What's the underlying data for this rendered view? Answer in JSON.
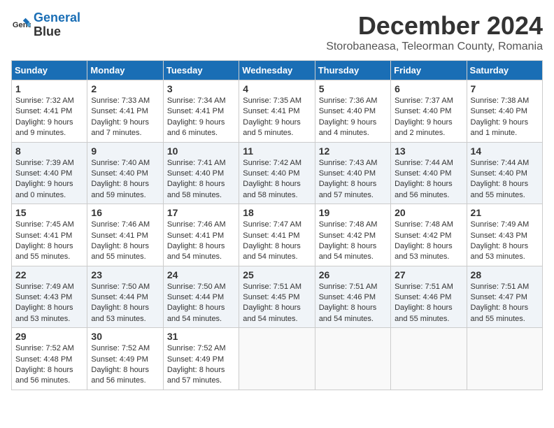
{
  "logo": {
    "line1": "General",
    "line2": "Blue"
  },
  "title": "December 2024",
  "location": "Storobaneasa, Teleorman County, Romania",
  "weekdays": [
    "Sunday",
    "Monday",
    "Tuesday",
    "Wednesday",
    "Thursday",
    "Friday",
    "Saturday"
  ],
  "weeks": [
    [
      {
        "day": "1",
        "sunrise": "7:32 AM",
        "sunset": "4:41 PM",
        "daylight": "9 hours and 9 minutes."
      },
      {
        "day": "2",
        "sunrise": "7:33 AM",
        "sunset": "4:41 PM",
        "daylight": "9 hours and 7 minutes."
      },
      {
        "day": "3",
        "sunrise": "7:34 AM",
        "sunset": "4:41 PM",
        "daylight": "9 hours and 6 minutes."
      },
      {
        "day": "4",
        "sunrise": "7:35 AM",
        "sunset": "4:41 PM",
        "daylight": "9 hours and 5 minutes."
      },
      {
        "day": "5",
        "sunrise": "7:36 AM",
        "sunset": "4:40 PM",
        "daylight": "9 hours and 4 minutes."
      },
      {
        "day": "6",
        "sunrise": "7:37 AM",
        "sunset": "4:40 PM",
        "daylight": "9 hours and 2 minutes."
      },
      {
        "day": "7",
        "sunrise": "7:38 AM",
        "sunset": "4:40 PM",
        "daylight": "9 hours and 1 minute."
      }
    ],
    [
      {
        "day": "8",
        "sunrise": "7:39 AM",
        "sunset": "4:40 PM",
        "daylight": "9 hours and 0 minutes."
      },
      {
        "day": "9",
        "sunrise": "7:40 AM",
        "sunset": "4:40 PM",
        "daylight": "8 hours and 59 minutes."
      },
      {
        "day": "10",
        "sunrise": "7:41 AM",
        "sunset": "4:40 PM",
        "daylight": "8 hours and 58 minutes."
      },
      {
        "day": "11",
        "sunrise": "7:42 AM",
        "sunset": "4:40 PM",
        "daylight": "8 hours and 58 minutes."
      },
      {
        "day": "12",
        "sunrise": "7:43 AM",
        "sunset": "4:40 PM",
        "daylight": "8 hours and 57 minutes."
      },
      {
        "day": "13",
        "sunrise": "7:44 AM",
        "sunset": "4:40 PM",
        "daylight": "8 hours and 56 minutes."
      },
      {
        "day": "14",
        "sunrise": "7:44 AM",
        "sunset": "4:40 PM",
        "daylight": "8 hours and 55 minutes."
      }
    ],
    [
      {
        "day": "15",
        "sunrise": "7:45 AM",
        "sunset": "4:41 PM",
        "daylight": "8 hours and 55 minutes."
      },
      {
        "day": "16",
        "sunrise": "7:46 AM",
        "sunset": "4:41 PM",
        "daylight": "8 hours and 55 minutes."
      },
      {
        "day": "17",
        "sunrise": "7:46 AM",
        "sunset": "4:41 PM",
        "daylight": "8 hours and 54 minutes."
      },
      {
        "day": "18",
        "sunrise": "7:47 AM",
        "sunset": "4:41 PM",
        "daylight": "8 hours and 54 minutes."
      },
      {
        "day": "19",
        "sunrise": "7:48 AM",
        "sunset": "4:42 PM",
        "daylight": "8 hours and 54 minutes."
      },
      {
        "day": "20",
        "sunrise": "7:48 AM",
        "sunset": "4:42 PM",
        "daylight": "8 hours and 53 minutes."
      },
      {
        "day": "21",
        "sunrise": "7:49 AM",
        "sunset": "4:43 PM",
        "daylight": "8 hours and 53 minutes."
      }
    ],
    [
      {
        "day": "22",
        "sunrise": "7:49 AM",
        "sunset": "4:43 PM",
        "daylight": "8 hours and 53 minutes."
      },
      {
        "day": "23",
        "sunrise": "7:50 AM",
        "sunset": "4:44 PM",
        "daylight": "8 hours and 53 minutes."
      },
      {
        "day": "24",
        "sunrise": "7:50 AM",
        "sunset": "4:44 PM",
        "daylight": "8 hours and 54 minutes."
      },
      {
        "day": "25",
        "sunrise": "7:51 AM",
        "sunset": "4:45 PM",
        "daylight": "8 hours and 54 minutes."
      },
      {
        "day": "26",
        "sunrise": "7:51 AM",
        "sunset": "4:46 PM",
        "daylight": "8 hours and 54 minutes."
      },
      {
        "day": "27",
        "sunrise": "7:51 AM",
        "sunset": "4:46 PM",
        "daylight": "8 hours and 55 minutes."
      },
      {
        "day": "28",
        "sunrise": "7:51 AM",
        "sunset": "4:47 PM",
        "daylight": "8 hours and 55 minutes."
      }
    ],
    [
      {
        "day": "29",
        "sunrise": "7:52 AM",
        "sunset": "4:48 PM",
        "daylight": "8 hours and 56 minutes."
      },
      {
        "day": "30",
        "sunrise": "7:52 AM",
        "sunset": "4:49 PM",
        "daylight": "8 hours and 56 minutes."
      },
      {
        "day": "31",
        "sunrise": "7:52 AM",
        "sunset": "4:49 PM",
        "daylight": "8 hours and 57 minutes."
      },
      null,
      null,
      null,
      null
    ]
  ]
}
